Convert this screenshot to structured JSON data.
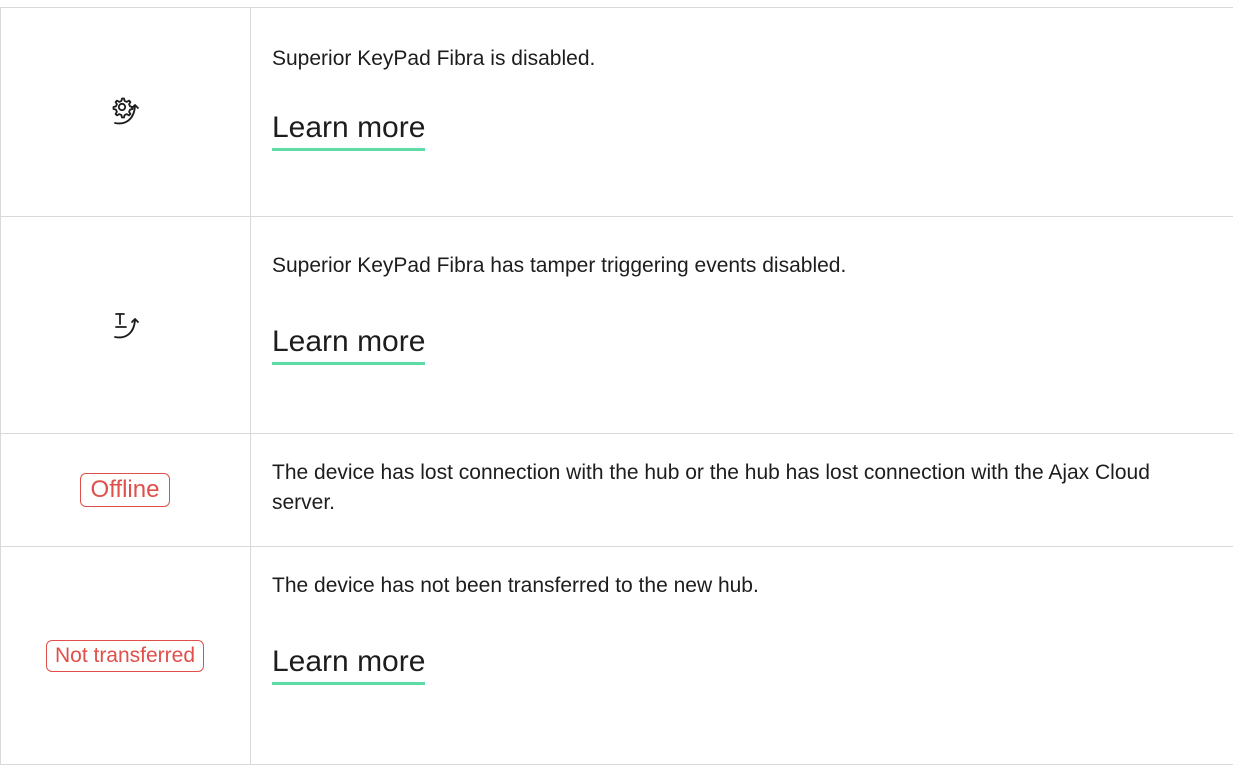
{
  "rows": [
    {
      "icon": "gear-arrow-icon",
      "description": "Superior KeyPad Fibra is disabled.",
      "link": "Learn more"
    },
    {
      "icon": "tamper-arrow-icon",
      "description": "Superior KeyPad Fibra has tamper triggering events disabled.",
      "link": "Learn more"
    },
    {
      "badge": "Offline",
      "description": "The device has lost connection with the hub or the hub has lost connection with the Ajax Cloud server."
    },
    {
      "badge": "Not transferred",
      "description": "The device has not been transferred to the new hub.",
      "link": "Learn more"
    }
  ],
  "colors": {
    "badge": "#e0504a",
    "link_underline": "#5fdba6",
    "border": "#d9d9d9"
  }
}
